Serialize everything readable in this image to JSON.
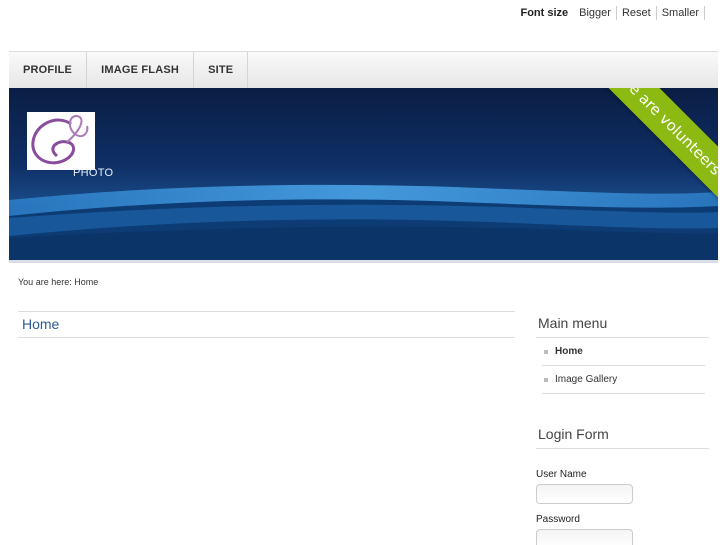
{
  "font_size_bar": {
    "label": "Font size",
    "bigger": "Bigger",
    "reset": "Reset",
    "smaller": "Smaller"
  },
  "nav": {
    "items": [
      {
        "label": "PROFILE"
      },
      {
        "label": "IMAGE FLASH"
      },
      {
        "label": "SITE"
      }
    ]
  },
  "banner": {
    "logo_caption": "PHOTO",
    "ribbon_text": "We are volunteers !",
    "colors": {
      "ribbon": "#8dba12",
      "background": "#0f2f66"
    }
  },
  "breadcrumb": {
    "text": "You are here: Home"
  },
  "main": {
    "title": "Home"
  },
  "main_menu": {
    "title": "Main menu",
    "items": [
      {
        "label": "Home",
        "active": true
      },
      {
        "label": "Image Gallery",
        "active": false
      }
    ]
  },
  "login_form": {
    "title": "Login Form",
    "username_label": "User Name",
    "password_label": "Password"
  }
}
